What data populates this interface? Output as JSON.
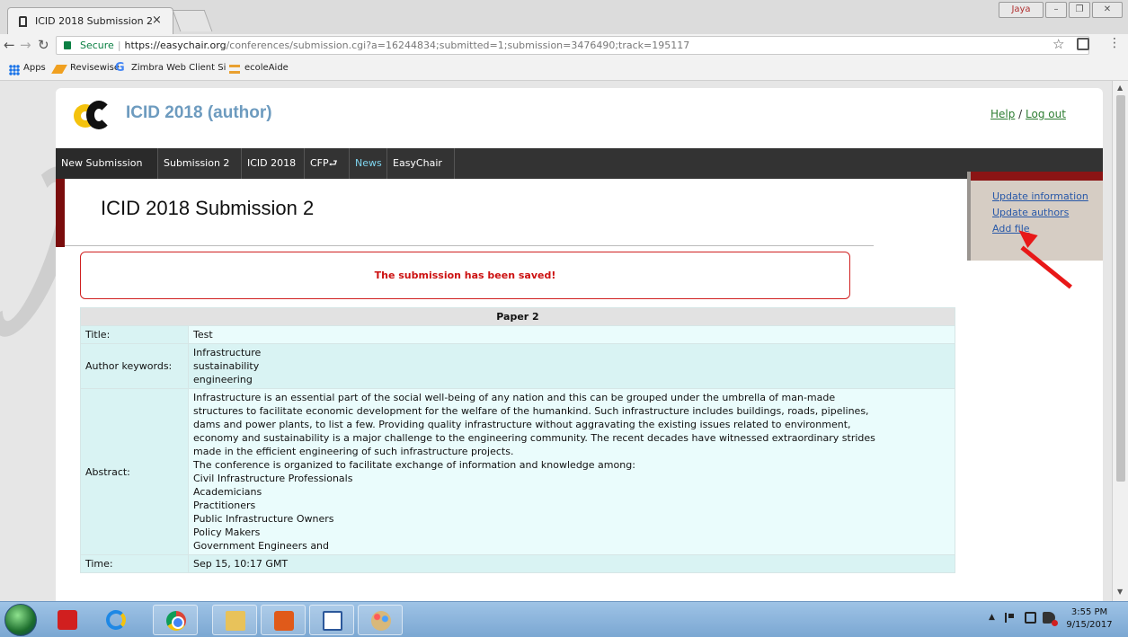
{
  "browser": {
    "tab_title": "ICID 2018 Submission 2",
    "tab_close": "×",
    "window_user": "Jaya",
    "secure_label": "Secure",
    "url_host": "https://easychair.org",
    "url_path": "/conferences/submission.cgi?a=16244834;submitted=1;submission=3476490;track=195117",
    "bookmarks": {
      "apps": "Apps",
      "revisewise": "Revisewise",
      "zimbra": "Zimbra Web Client Si",
      "ecole": "ecoleAide"
    }
  },
  "header": {
    "site_title": "ICID 2018 (author)",
    "help": "Help",
    "separator": " / ",
    "logout": "Log out"
  },
  "nav": {
    "new_submission": "New Submission",
    "submission2": "Submission 2",
    "icid": "ICID 2018",
    "cfp": "CFP",
    "news": "News",
    "easychair": "EasyChair"
  },
  "side_panel": {
    "update_information": "Update information",
    "update_authors": "Update authors",
    "add_file": "Add file"
  },
  "page": {
    "heading": "ICID 2018 Submission 2",
    "saved_message": "The submission has been saved!"
  },
  "paper": {
    "header": "Paper 2",
    "title_label": "Title:",
    "title_value": "Test",
    "keywords_label": "Author keywords:",
    "keywords": [
      "Infrastructure",
      "sustainability",
      "engineering"
    ],
    "abstract_label": "Abstract:",
    "abstract_lines": [
      "Infrastructure is an essential part of the social well-being of any nation and this can be grouped under the umbrella of man-made",
      "structures to facilitate economic development for the welfare of the humankind. Such infrastructure includes buildings, roads, pipelines,",
      "dams and power plants, to list a few. Providing quality infrastructure without aggravating the existing issues related to environment,",
      "economy and sustainability is a major challenge to the engineering community. The recent decades have witnessed extraordinary strides",
      "made in the efficient engineering of such infrastructure projects.",
      "The conference is organized to facilitate exchange of information and knowledge among:",
      "Civil Infrastructure Professionals",
      "Academicians",
      "Practitioners",
      "Public Infrastructure Owners",
      "Policy Makers",
      "Government Engineers and"
    ],
    "time_label": "Time:",
    "time_value": "Sep 15, 10:17 GMT"
  },
  "taskbar": {
    "clock_time": "3:55 PM",
    "clock_date": "9/15/2017"
  },
  "colors": {
    "nav_bg": "#333333",
    "accent_red": "#8b1414",
    "link_blue": "#2858a8",
    "table_label_bg": "#d9f3f3"
  }
}
